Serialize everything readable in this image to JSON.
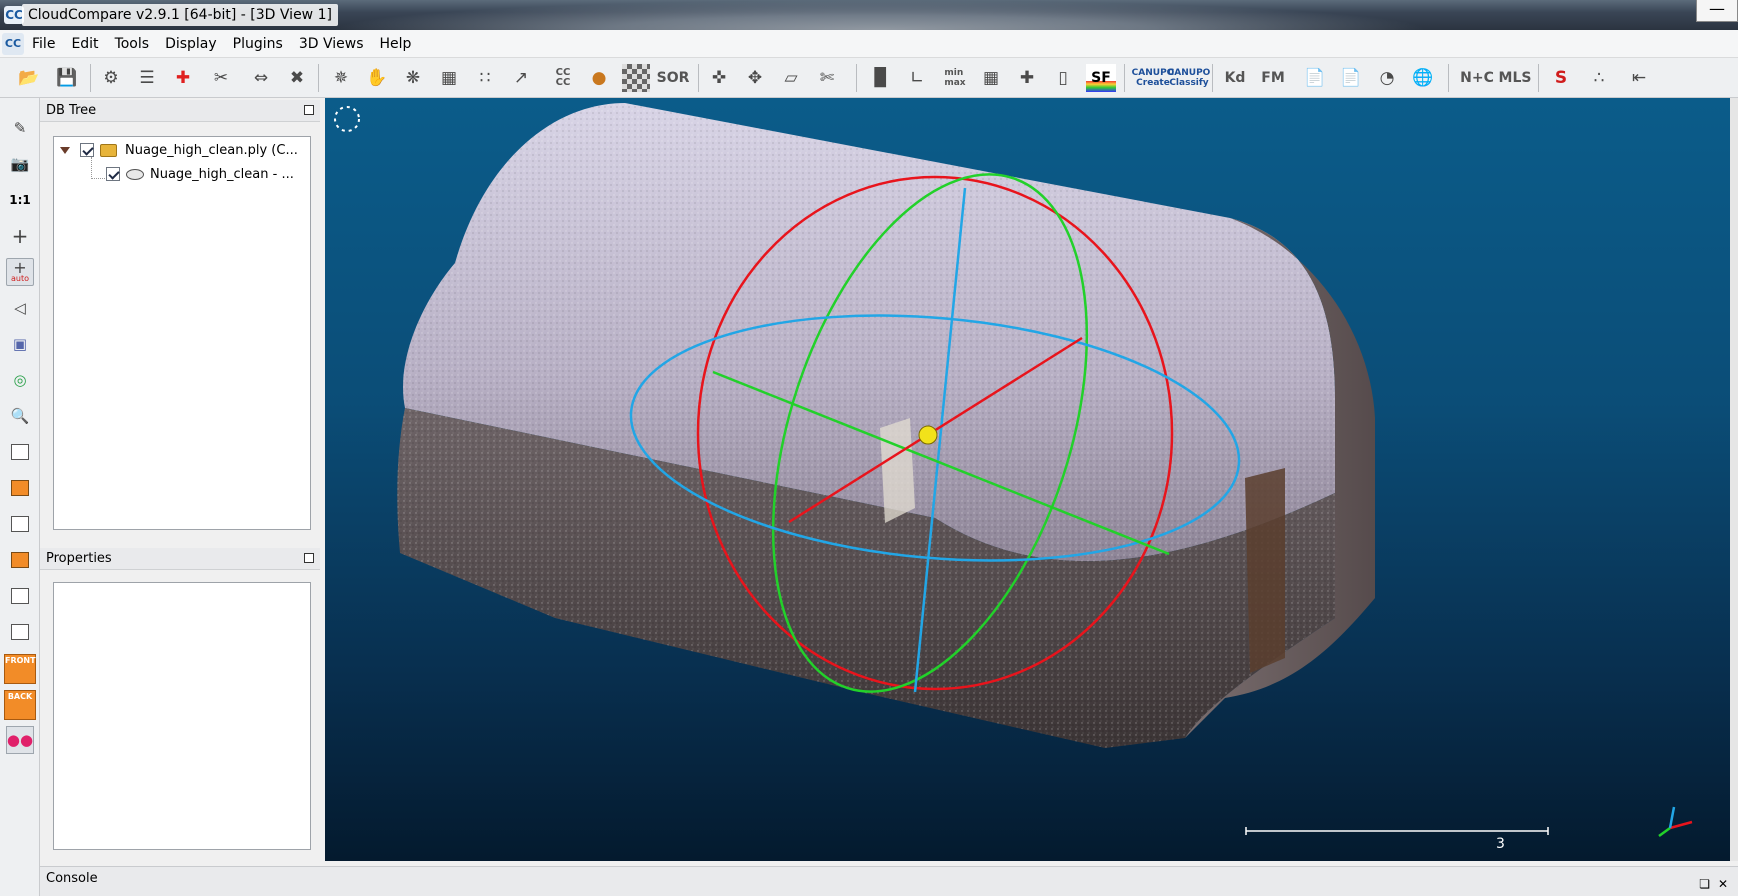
{
  "window": {
    "title": "CloudCompare v2.9.1 [64-bit] - [3D View 1]",
    "app_icon_label": "CC",
    "minimize_glyph": "—"
  },
  "menu": {
    "items": [
      "File",
      "Edit",
      "Tools",
      "Display",
      "Plugins",
      "3D Views",
      "Help"
    ]
  },
  "toolbar": {
    "sor_label": "SOR",
    "sf_label": "SF",
    "cc_label": "CC\nCC",
    "canupo_create_label": "CANUPO",
    "canupo_create_sub": "Create",
    "canupo_classify_label": "CANUPO",
    "canupo_classify_sub": "Classify",
    "kd_label": "Kd",
    "fm_label": "FM",
    "nc_label": "N+C",
    "mls_label": "MLS",
    "minmax_label": "min\nmax"
  },
  "left_toolbar": {
    "ratio_label": "1:1",
    "auto_label": "auto",
    "front_label": "FRONT",
    "back_label": "BACK"
  },
  "db_tree": {
    "header": "DB Tree",
    "items": [
      {
        "label": "Nuage_high_clean.ply (C...",
        "checked": true,
        "icon": "folder-icon"
      },
      {
        "label": "Nuage_high_clean - ...",
        "checked": true,
        "icon": "point-cloud-icon"
      }
    ]
  },
  "properties": {
    "header": "Properties"
  },
  "view3d": {
    "scale_value": "3",
    "colors": {
      "background_top": "#0b5c8a",
      "background_bottom": "#041a2e",
      "gizmo_x": "#e8141c",
      "gizmo_y": "#22d12a",
      "gizmo_z": "#22a6e6",
      "pivot": "#f2e21a"
    }
  },
  "console": {
    "header": "Console"
  }
}
